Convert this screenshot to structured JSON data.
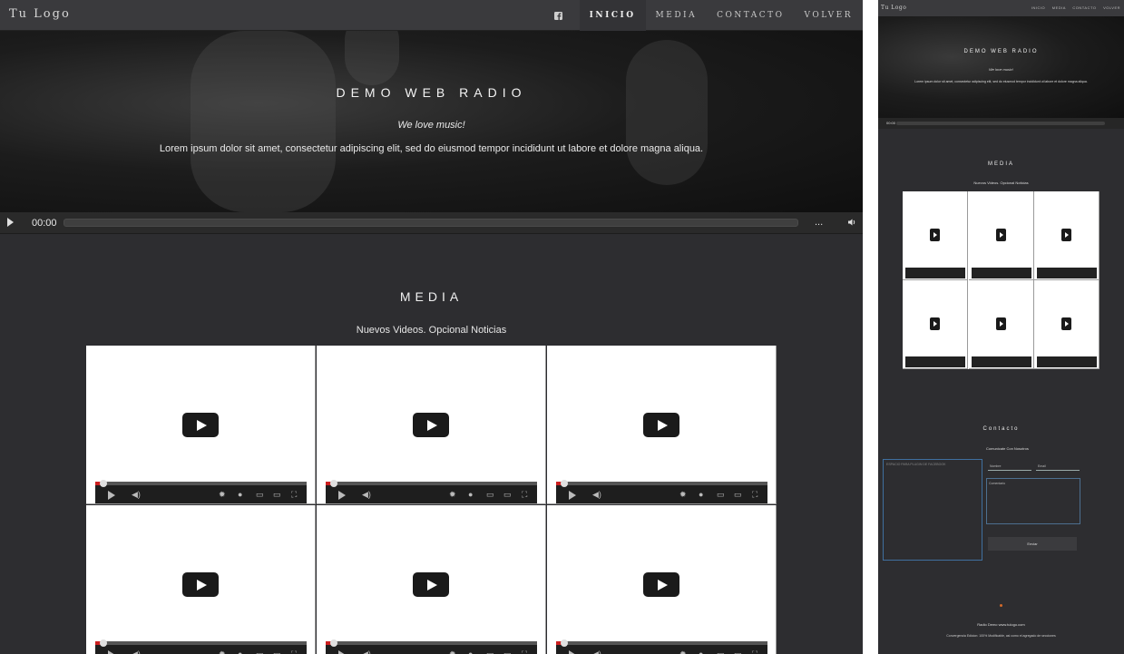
{
  "site": {
    "logo": "Tu Logo",
    "social_icons": [
      "facebook-icon",
      "messenger-icon",
      "instagram-icon"
    ],
    "nav": [
      {
        "label": "INICIO",
        "active": true
      },
      {
        "label": "MEDIA",
        "active": false
      },
      {
        "label": "CONTACTO",
        "active": false
      },
      {
        "label": "VOLVER",
        "active": false
      }
    ]
  },
  "hero": {
    "title": "DEMO WEB RADIO",
    "tagline": "We love music!",
    "text": "Lorem ipsum dolor sit amet, consectetur adipiscing elit, sed do eiusmod tempor incididunt ut labore et dolore magna aliqua."
  },
  "player": {
    "time": "00:00",
    "more": "...",
    "play_icon": "play-icon",
    "volume_icon": "volume-icon"
  },
  "media": {
    "title": "MEDIA",
    "subtitle": "Nuevos Videos. Opcional Noticias",
    "video_count": 6
  },
  "thumbnail": {
    "logo": "Tu Logo",
    "nav": [
      "INICIO",
      "MEDIA",
      "CONTACTO",
      "VOLVER"
    ],
    "hero_title": "DEMO WEB RADIO",
    "hero_tagline": "We love music!",
    "hero_text": "Lorem ipsum dolor sit amet, consectetur adipiscing elit, sed do eiusmod tempor incididunt ut labore et dolore magna aliqua.",
    "player_time": "00:00",
    "media_title": "MEDIA",
    "media_subtitle": "Nuevos Videos. Opcional Noticias",
    "contact_title": "Contacto",
    "contact_subtitle": "Comunicate Con Nosotros",
    "facebook_box_label": "ESPACIO PARA PLUGIN DE FACEBOOK",
    "name_placeholder": "Nombre",
    "email_placeholder": "Email",
    "message_placeholder": "Comentario",
    "send_label": "Enviar",
    "footer_line1": "Radio Demo www.tulogo.com",
    "footer_line2": "Convergencia Edicion: 100% Modificable, asi como el agregado de secciones"
  },
  "colors": {
    "background": "#2d2d30",
    "navbar": "#3a3a3d",
    "text": "#f0f0f0",
    "accent_red": "#cc1f1f"
  }
}
